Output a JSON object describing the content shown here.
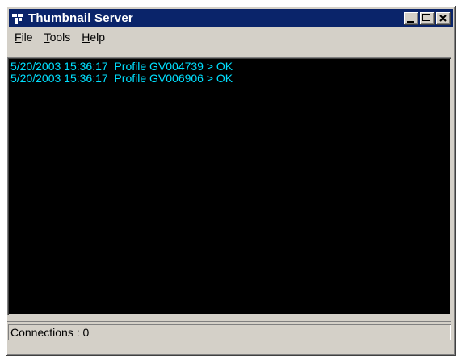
{
  "window": {
    "title": "Thumbnail Server",
    "title_bar_color": "#0a246a"
  },
  "caption_buttons": {
    "minimize_icon": "minimize-icon",
    "maximize_icon": "maximize-icon",
    "close_icon": "close-icon"
  },
  "menu": {
    "items": [
      {
        "label_prefix": "",
        "label_underlined": "F",
        "label_rest": "ile"
      },
      {
        "label_prefix": "",
        "label_underlined": "T",
        "label_rest": "ools"
      },
      {
        "label_prefix": "",
        "label_underlined": "H",
        "label_rest": "elp"
      }
    ]
  },
  "log": {
    "text_color": "#00e0ff",
    "background": "#000000",
    "lines": [
      "5/20/2003 15:36:17  Profile GV004739 > OK",
      "5/20/2003 15:36:17  Profile GV006906 > OK"
    ]
  },
  "status": {
    "text": "Connections : 0"
  }
}
